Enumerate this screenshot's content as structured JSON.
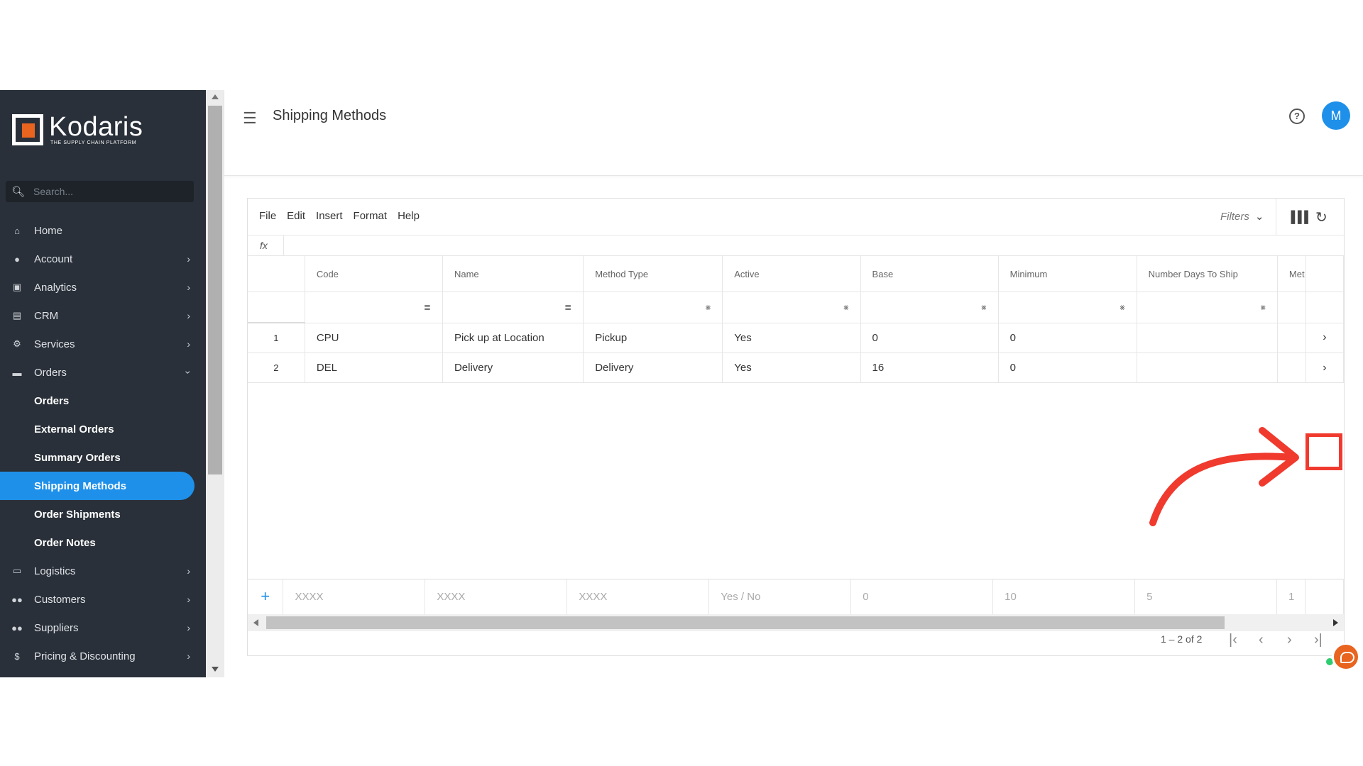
{
  "brand": {
    "name": "Kodaris",
    "tagline": "THE SUPPLY CHAIN PLATFORM"
  },
  "search": {
    "placeholder": "Search..."
  },
  "nav": {
    "items": [
      {
        "label": "Home",
        "icon": "home-icon"
      },
      {
        "label": "Account",
        "icon": "person-icon"
      },
      {
        "label": "Analytics",
        "icon": "analytics-icon"
      },
      {
        "label": "CRM",
        "icon": "crm-icon"
      },
      {
        "label": "Services",
        "icon": "services-icon"
      },
      {
        "label": "Orders",
        "icon": "truck-icon"
      },
      {
        "label": "Logistics",
        "icon": "logistics-icon"
      },
      {
        "label": "Customers",
        "icon": "people-icon"
      },
      {
        "label": "Suppliers",
        "icon": "people-icon"
      },
      {
        "label": "Pricing & Discounting",
        "icon": "dollar-icon"
      }
    ],
    "orders_sub": [
      "Orders",
      "External Orders",
      "Summary Orders",
      "Shipping Methods",
      "Order Shipments",
      "Order Notes"
    ],
    "active": "Shipping Methods"
  },
  "header": {
    "title": "Shipping Methods",
    "avatar_initial": "M"
  },
  "toolbar": {
    "menus": [
      "File",
      "Edit",
      "Insert",
      "Format",
      "Help"
    ],
    "filters_label": "Filters"
  },
  "formula": {
    "label": "fx"
  },
  "grid": {
    "columns": [
      "Code",
      "Name",
      "Method Type",
      "Active",
      "Base",
      "Minimum",
      "Number Days To Ship",
      "Met"
    ],
    "rows": [
      {
        "num": "1",
        "cells": [
          "CPU",
          "Pick up at Location",
          "Pickup",
          "Yes",
          "0",
          "0",
          ""
        ]
      },
      {
        "num": "2",
        "cells": [
          "DEL",
          "Delivery",
          "Delivery",
          "Yes",
          "16",
          "0",
          ""
        ]
      }
    ],
    "new_row_placeholders": [
      "XXXX",
      "XXXX",
      "XXXX",
      "Yes / No",
      "0",
      "10",
      "5",
      "1"
    ]
  },
  "pagination": {
    "range": "1 – 2 of 2"
  },
  "colors": {
    "accent": "#1e90ea",
    "sidebar": "#293039",
    "annotation": "#f03a2e",
    "brand_orange": "#e8641f"
  }
}
